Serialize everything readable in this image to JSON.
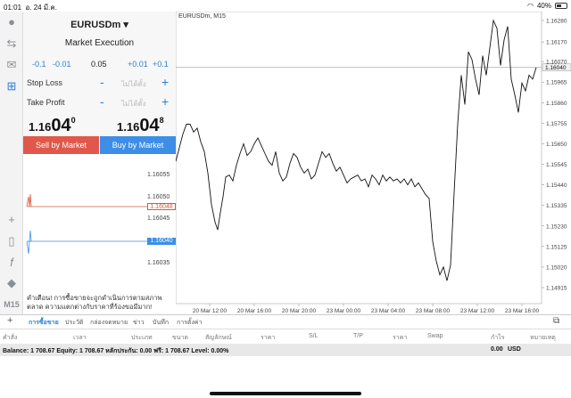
{
  "status": {
    "time": "01:01",
    "date": "อ. 24 มี.ค.",
    "battery": "40%"
  },
  "panel": {
    "symbol": "EURUSDm",
    "execution": "Market Execution",
    "vol_minus_big": "-0.1",
    "vol_minus_small": "-0.01",
    "volume": "0.05",
    "vol_plus_small": "+0.01",
    "vol_plus_big": "+0.1",
    "stop_loss_label": "Stop Loss",
    "take_profit_label": "Take Profit",
    "sl_placeholder": "ไม่ได้ตั้ง",
    "tp_placeholder": "ไม่ได้ตั้ง",
    "minus": "-",
    "plus": "+",
    "sell_small": "1.16",
    "sell_big": "04",
    "sell_sup": "0",
    "buy_small": "1.16",
    "buy_big": "04",
    "buy_sup": "8",
    "sell_label": "Sell by Market",
    "buy_label": "Buy by Market"
  },
  "mini": {
    "ticks": [
      "1.16055",
      "1.16050",
      "1.16045",
      "1.16035"
    ],
    "ask_tag": "1.16048",
    "bid_tag": "1.16040"
  },
  "warning": "คำเตือน! การซื้อขายจะถูกดำเนินการตามสภาพตลาด ความแตกต่างกับราคาที่ร้องขอมีมาก!",
  "chart": {
    "title": "EURUSDm, M15",
    "current_price": "1.16040",
    "y_ticks": [
      "1.16280",
      "1.16170",
      "1.16070",
      "1.15965",
      "1.15860",
      "1.15755",
      "1.15650",
      "1.15545",
      "1.15440",
      "1.15335",
      "1.15230",
      "1.15125",
      "1.15020",
      "1.14915"
    ],
    "x_ticks": [
      "20 Mar 12:00",
      "20 Mar 16:00",
      "20 Mar 20:00",
      "23 Mar 00:00",
      "23 Mar 04:00",
      "23 Mar 08:00",
      "23 Mar 12:00",
      "23 Mar 16:00"
    ]
  },
  "chart_data": {
    "type": "line",
    "title": "EURUSDm, M15",
    "x": [
      "20 Mar 12:00",
      "20 Mar 16:00",
      "20 Mar 20:00",
      "23 Mar 00:00",
      "23 Mar 04:00",
      "23 Mar 08:00",
      "23 Mar 12:00",
      "23 Mar 16:00"
    ],
    "series": [
      {
        "name": "EURUSDm",
        "values": [
          1.1556,
          1.1521,
          1.1553,
          1.155,
          1.155,
          1.1495,
          1.1608,
          1.1604
        ]
      }
    ],
    "ylim": [
      1.14915,
      1.1628
    ],
    "current_price": 1.1604
  },
  "tabs": [
    "การซื้อขาย",
    "ประวัติ",
    "กล่องจดหมาย",
    "ข่าว",
    "บันทึก",
    "การตั้งค่า"
  ],
  "columns": [
    "คำสั่ง",
    "เวลา",
    "ประเภท",
    "ขนาด",
    "สัญลักษณ์",
    "ราคา",
    "S/L",
    "T/P",
    "ราคา",
    "Swap",
    "กำไร",
    "หมายเหตุ"
  ],
  "balance": {
    "text": "Balance: 1 708.67 Equity: 1 708.67 หลักประกัน: 0.00 ฟรี: 1 708.67 Level: 0.00%",
    "profit": "0.00",
    "currency": "USD"
  }
}
